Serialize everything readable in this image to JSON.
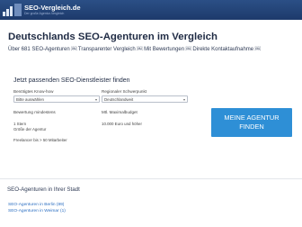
{
  "logo": {
    "title": "SEO-Vergleich.de",
    "tagline": "Der große Agentur-Vergleich"
  },
  "hero": {
    "title": "Deutschlands SEO-Agenturen im Vergleich",
    "subtitle": "Über 681 SEO-Agenturen ￼ Transparenter Vergleich ￼ Mit Bewertungen ￼ Direkte Kontaktaufnahme ￼"
  },
  "search": {
    "title": "Jetzt passenden SEO-Dienstleister finden",
    "knowhow_label": "Benötigtes Know-how",
    "knowhow_value": "Bitte auswählen",
    "region_label": "Regionaler Schwerpunkt",
    "region_value": "Deutschlandweit",
    "rating_label": "Bewertung mindestens",
    "rating_value": "1 Stern",
    "size_label": "Größe der Agentur",
    "size_value": "Freelancer bis > 50 Mitarbeiter",
    "budget_label": "Mtl. Maximalbudget",
    "budget_value": "10.000 Euro und höher",
    "cta_line1": "MEINE AGENTUR",
    "cta_line2": "FINDEN"
  },
  "footer": {
    "title": "SEO-Agenturen in Ihrer Stadt",
    "links": [
      "SEO-Agenturen in Berlin (89)",
      "SEO-Agenturen in Weimar (1)"
    ]
  },
  "colors": {
    "header_bg": "#1d3a6b",
    "cta_bg": "#2e8fd6",
    "link": "#2c6fc2"
  }
}
